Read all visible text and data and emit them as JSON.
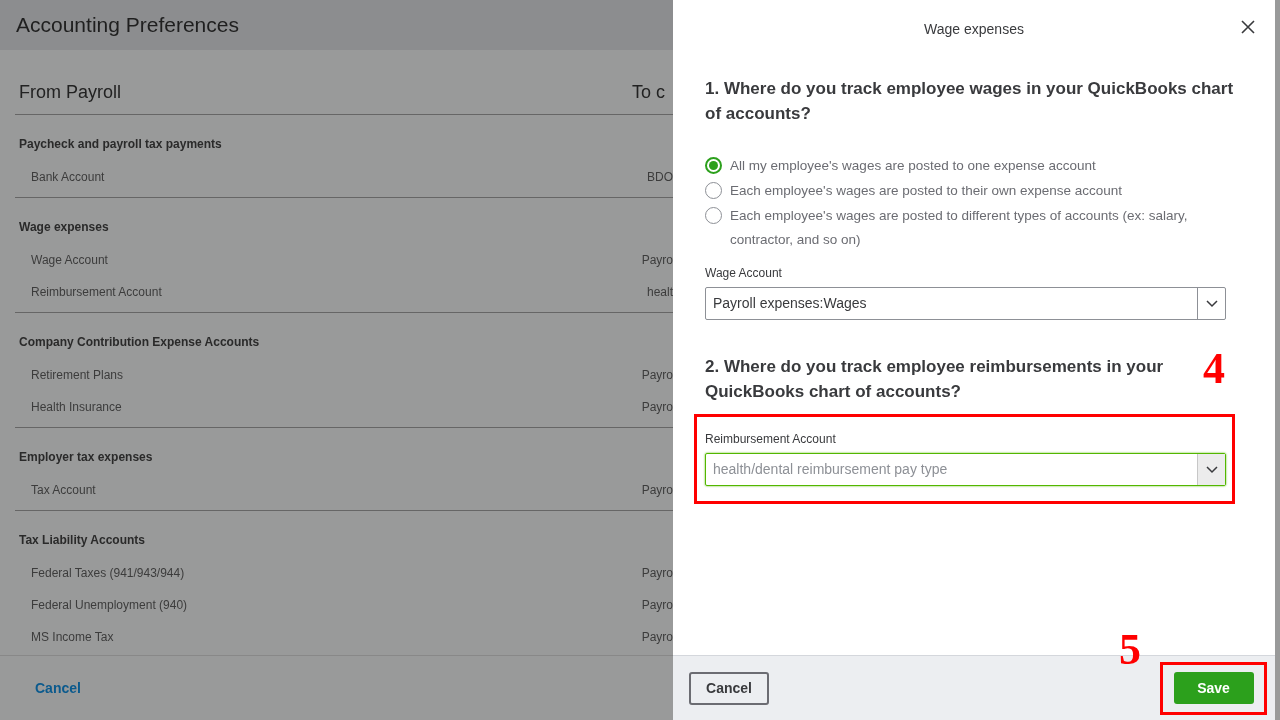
{
  "background_page": {
    "title": "Accounting Preferences",
    "column_1": "From Payroll",
    "column_2": "To c",
    "sections": [
      {
        "title": "Paycheck and payroll tax payments",
        "rows": [
          {
            "label": "Bank Account",
            "value": "BDO"
          }
        ]
      },
      {
        "title": "Wage expenses",
        "rows": [
          {
            "label": "Wage Account",
            "value": "Payro"
          },
          {
            "label": "Reimbursement Account",
            "value": "healt"
          }
        ]
      },
      {
        "title": "Company Contribution Expense Accounts",
        "rows": [
          {
            "label": "Retirement Plans",
            "value": "Payro"
          },
          {
            "label": "Health Insurance",
            "value": "Payro"
          }
        ]
      },
      {
        "title": "Employer tax expenses",
        "rows": [
          {
            "label": "Tax Account",
            "value": "Payro"
          }
        ]
      },
      {
        "title": "Tax Liability Accounts",
        "rows": [
          {
            "label": "Federal Taxes (941/943/944)",
            "value": "Payro"
          },
          {
            "label": "Federal Unemployment (940)",
            "value": "Payro"
          },
          {
            "label": "MS Income Tax",
            "value": "Payro"
          }
        ]
      }
    ],
    "cancel": "Cancel"
  },
  "panel": {
    "title": "Wage expenses",
    "question_1": "1. Where do you track employee wages in your QuickBooks chart of accounts?",
    "options": [
      {
        "label": "All my employee's wages are posted to one expense account",
        "selected": true
      },
      {
        "label": "Each employee's wages are posted to their own expense account",
        "selected": false
      },
      {
        "label": "Each employee's wages are posted to different types of accounts (ex: salary, contractor, and so on)",
        "selected": false
      }
    ],
    "wage_account": {
      "label": "Wage Account",
      "value": "Payroll expenses:Wages",
      "focused": false
    },
    "question_2": "2. Where do you track employee reimbursements in your QuickBooks chart of accounts?",
    "reimbursement_account": {
      "label": "Reimbursement Account",
      "value": "health/dental reimbursement pay type",
      "focused": true
    },
    "cancel": "Cancel",
    "save": "Save"
  },
  "annotations": [
    {
      "label": "4"
    },
    {
      "label": "5"
    }
  ]
}
